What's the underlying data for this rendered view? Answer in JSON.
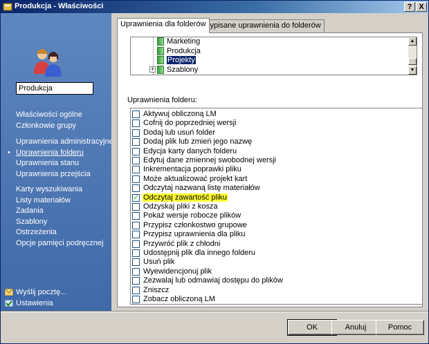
{
  "window": {
    "title": "Produkcja - Właściwości",
    "help_label": "?",
    "close_label": "X"
  },
  "sidebar": {
    "folder_name": "Produkcja",
    "active_bullet": "•",
    "nav_groups": [
      [
        "Właściwości ogólne",
        "Członkowie grupy"
      ],
      [
        "Uprawnienia administracyjne",
        "Uprawnienia folderu",
        "Uprawnienia stanu",
        "Uprawnienia przejścia"
      ],
      [
        "Karty wyszukiwania",
        "Listy materiałów",
        "Zadania",
        "Szablony",
        "Ostrzeżenia",
        "Opcje pamięci podręcznej"
      ]
    ],
    "active_item": "Uprawnienia folderu",
    "bottom_links": [
      "Wyślij pocztę...",
      "Ustawienia"
    ]
  },
  "tabs": [
    "Uprawnienia dla folderów",
    "Przypisane uprawnienia do folderów"
  ],
  "active_tab": 0,
  "tree": {
    "items": [
      "Marketing",
      "Produkcja",
      "Projekty",
      "Szablony"
    ],
    "selected": "Projekty",
    "expander_label": "+",
    "scroll_up": "▲",
    "scroll_down": "▼"
  },
  "permissions": {
    "label": "Uprawnienia folderu:",
    "check_mark": "✓",
    "items": [
      {
        "label": "Aktywuj obliczoną LM",
        "checked": false
      },
      {
        "label": "Cofnij do poprzedniej wersji",
        "checked": false
      },
      {
        "label": "Dodaj lub usuń folder",
        "checked": false
      },
      {
        "label": "Dodaj plik lub zmień jego nazwę",
        "checked": false
      },
      {
        "label": "Edycja karty danych folderu",
        "checked": false
      },
      {
        "label": "Edytuj dane zmiennej swobodnej wersji",
        "checked": false
      },
      {
        "label": "Inkrementacja poprawki pliku",
        "checked": false
      },
      {
        "label": "Może aktualizować projekt kart",
        "checked": false
      },
      {
        "label": "Odczytaj nazwaną listę materiałów",
        "checked": false
      },
      {
        "label": "Odczytaj zawartość pliku",
        "checked": true,
        "highlight": true
      },
      {
        "label": "Odzyskaj pliki z kosza",
        "checked": false
      },
      {
        "label": "Pokaż wersje robocze plików",
        "checked": false
      },
      {
        "label": "Przypisz członkostwo grupowe",
        "checked": false
      },
      {
        "label": "Przypisz uprawnienia dla pliku",
        "checked": false
      },
      {
        "label": "Przywróć plik z chłodni",
        "checked": false
      },
      {
        "label": "Udostępnij plik dla innego folderu",
        "checked": false
      },
      {
        "label": "Usuń plik",
        "checked": false
      },
      {
        "label": "Wyewidencjonuj plik",
        "checked": false
      },
      {
        "label": "Zezwalaj lub odmawiaj dostępu do plików",
        "checked": false
      },
      {
        "label": "Zniszcz",
        "checked": false
      },
      {
        "label": "Zobacz obliczoną LM",
        "checked": false
      }
    ]
  },
  "buttons": {
    "ok": "OK",
    "cancel": "Anuluj",
    "help": "Pomoc"
  },
  "colors": {
    "sidebar": "#4a73b0",
    "highlight": "#ffff33",
    "selection": "#0a246a"
  }
}
